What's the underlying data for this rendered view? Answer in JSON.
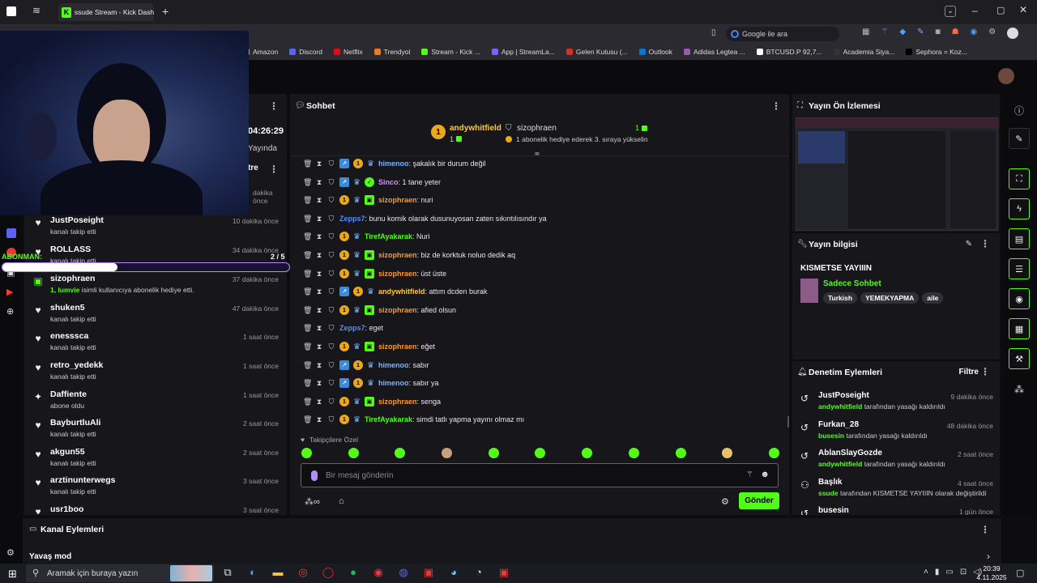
{
  "browser": {
    "tab_title": "ssude Stream - Kick Dashbo",
    "search_placeholder": "Google ile ara",
    "bookmarks": [
      {
        "label": "Amazon",
        "color": "#ff9900"
      },
      {
        "label": "Discord",
        "color": "#5865f2"
      },
      {
        "label": "Netflix",
        "color": "#e50914"
      },
      {
        "label": "Trendyol",
        "color": "#f27a1a"
      },
      {
        "label": "Stream - Kick ...",
        "color": "#53fc18"
      },
      {
        "label": "App | StreamLa...",
        "color": "#7b61ff"
      },
      {
        "label": "Gelen Kutusu (...",
        "color": "#d93025"
      },
      {
        "label": "Outlook",
        "color": "#0078d4"
      },
      {
        "label": "Adidas Legtea ...",
        "color": "#9b59b6"
      },
      {
        "label": "BTCUSD.P 92,7...",
        "color": "#ffffff"
      },
      {
        "label": "Academia Siya...",
        "color": "#333333"
      },
      {
        "label": "Sephora = Koz...",
        "color": "#000000"
      }
    ]
  },
  "left_panel": {
    "timer": "04:26:29",
    "live_label": "Yayında",
    "filter_label": "tre",
    "first_time": "dakika önce",
    "subgoal_label": "ABONMAN:",
    "subgoal_progress": "2 / 5",
    "subgoal_fraction": 0.4,
    "followers": [
      {
        "icon": "heart-icon",
        "glyph": "♥",
        "name": "JustPoseight",
        "desc": "kanalı takip etti",
        "time": "10 dakika önce"
      },
      {
        "icon": "heart-icon",
        "glyph": "♥",
        "name": "ROLLASS",
        "desc": "kanalı takip etti",
        "time": "34 dakika önce"
      },
      {
        "icon": "gift-icon",
        "glyph": "▣",
        "name": "sizophraen",
        "desc": "isimli kullanıcıya abonelik hediye etti.",
        "desc_prefix": "1, lumvie",
        "time": "37 dakika önce"
      },
      {
        "icon": "heart-icon",
        "glyph": "♥",
        "name": "shuken5",
        "desc": "kanalı takip etti",
        "time": "47 dakika önce"
      },
      {
        "icon": "heart-icon",
        "glyph": "♥",
        "name": "enesssca",
        "desc": "kanalı takip etti",
        "time": "1 saat önce"
      },
      {
        "icon": "heart-icon",
        "glyph": "♥",
        "name": "retro_yedekk",
        "desc": "kanalı takip etti",
        "time": "1 saat önce"
      },
      {
        "icon": "star-icon",
        "glyph": "✦",
        "name": "Daffiente",
        "desc": "abone oldu",
        "time": "1 saat önce"
      },
      {
        "icon": "heart-icon",
        "glyph": "♥",
        "name": "BayburtluAli",
        "desc": "kanalı takip etti",
        "time": "2 saat önce"
      },
      {
        "icon": "heart-icon",
        "glyph": "♥",
        "name": "akgun55",
        "desc": "kanalı takip etti",
        "time": "2 saat önce"
      },
      {
        "icon": "heart-icon",
        "glyph": "♥",
        "name": "arztinunterwegs",
        "desc": "kanalı takip etti",
        "time": "3 saat önce"
      },
      {
        "icon": "heart-icon",
        "glyph": "♥",
        "name": "usr1boo",
        "desc": "",
        "time": "3 saat önce"
      }
    ]
  },
  "chat": {
    "title": "Sohbet",
    "pinned": {
      "gifter": "andywhitfield",
      "gifter_count": "1",
      "recipient": "sizophraen",
      "recipient_count": "1",
      "text": "1 abonelik hediye ederek 3. sıraya yükselin"
    },
    "messages": [
      {
        "user": "himenoo",
        "color": "#7ab4ff",
        "badges": [
          "blue",
          "gold",
          "crown"
        ],
        "text": "şakalık bir durum değil"
      },
      {
        "user": "Sinco",
        "color": "#d78bff",
        "badges": [
          "blue",
          "crown",
          "verified"
        ],
        "text": "1 tane yeter"
      },
      {
        "user": "sizophraen",
        "color": "#ff9a1f",
        "badges": [
          "gold",
          "crown",
          "green"
        ],
        "text": "nuri"
      },
      {
        "user": "Zepps7",
        "color": "#4f8fff",
        "badges": [],
        "text": "bunu komik olarak dusunuyosan zaten sıkıntılısındır ya"
      },
      {
        "user": "TirefAyakarak",
        "color": "#53fc18",
        "badges": [
          "gold",
          "crown"
        ],
        "text": "Nuri"
      },
      {
        "user": "sizophraen",
        "color": "#ff9a1f",
        "badges": [
          "gold",
          "crown",
          "green"
        ],
        "text": "biz de korktuk noluo dedik aq"
      },
      {
        "user": "sizophraen",
        "color": "#ff9a1f",
        "badges": [
          "gold",
          "crown",
          "green"
        ],
        "text": "üst üste"
      },
      {
        "user": "andywhitfield",
        "color": "#ffc93c",
        "badges": [
          "blue",
          "gold",
          "crown"
        ],
        "text": "attım dcden burak"
      },
      {
        "user": "sizophraen",
        "color": "#ff9a1f",
        "badges": [
          "gold",
          "crown",
          "green"
        ],
        "text": "afied olsun"
      },
      {
        "user": "Zepps7",
        "color": "#4f8fff",
        "badges": [],
        "text": "eget"
      },
      {
        "user": "sizophraen",
        "color": "#ff9a1f",
        "badges": [
          "gold",
          "crown",
          "green"
        ],
        "text": "eğet"
      },
      {
        "user": "himenoo",
        "color": "#7ab4ff",
        "badges": [
          "blue",
          "gold",
          "crown"
        ],
        "text": "sabır"
      },
      {
        "user": "himenoo",
        "color": "#7ab4ff",
        "badges": [
          "blue",
          "gold",
          "crown"
        ],
        "text": "sabır ya"
      },
      {
        "user": "sizophraen",
        "color": "#ff9a1f",
        "badges": [
          "gold",
          "crown",
          "green"
        ],
        "text": "senga"
      },
      {
        "user": "TirefAyakarak",
        "color": "#53fc18",
        "badges": [
          "gold",
          "crown"
        ],
        "text": "simdi tatlı yapma yayını olmaz mı"
      }
    ],
    "followers_only": "Takipçilere Özel",
    "input_placeholder": "Bir mesaj gönderin",
    "send_label": "Gönder"
  },
  "preview": {
    "title": "Yayın Ön İzlemesi"
  },
  "info": {
    "title": "Yayın bilgisi",
    "stream_title": "KISMETSE YAYIIIN",
    "category": "Sadece Sohbet",
    "tags": [
      "Turkish",
      "YEMEKYAPMA",
      "aile"
    ]
  },
  "mod": {
    "title": "Denetim Eylemleri",
    "filter_label": "Filtre",
    "actions": [
      {
        "icon": "undo-icon",
        "glyph": "↺",
        "name": "JustPoseight",
        "by": "andywhitfield",
        "desc": "tarafından yasağı kaldırıldı",
        "time": "9 dakika önce"
      },
      {
        "icon": "undo-icon",
        "glyph": "↺",
        "name": "Furkan_28",
        "by": "busesin",
        "desc": "tarafından yasağı kaldırıldı",
        "time": "48 dakika önce"
      },
      {
        "icon": "undo-icon",
        "glyph": "↺",
        "name": "AblanSlayGozde",
        "by": "andywhitfield",
        "desc": "tarafından yasağı kaldırıldı",
        "time": "2 saat önce"
      },
      {
        "icon": "title-icon",
        "glyph": "⚇",
        "name": "Başlık",
        "by": "ssude",
        "desc": "tarafından KISMETSE YAYIIIN olarak değiştirildi",
        "time": "4 saat önce"
      },
      {
        "icon": "undo-icon",
        "glyph": "↺",
        "name": "busesin",
        "by": "",
        "desc": "",
        "time": "1 gün önce"
      }
    ]
  },
  "channel_actions": {
    "title": "Kanal Eylemleri",
    "first_item": "Yavaş mod"
  },
  "taskbar": {
    "search_placeholder": "Aramak için buraya yazın",
    "time": "20:39",
    "date": "4.11.2025"
  }
}
